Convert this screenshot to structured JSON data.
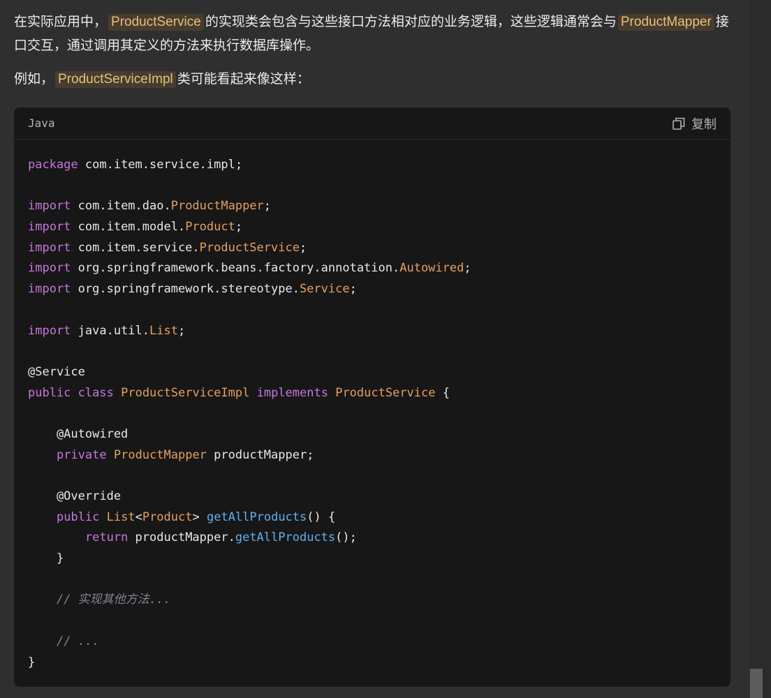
{
  "message": {
    "paragraph1": {
      "part1": "在实际应用中，",
      "code1": "ProductService",
      "part2": "的实现类会包含与这些接口方法相对应的业务逻辑，这些逻辑通常会与",
      "code2": "ProductMapper",
      "part3": "接口交互，通过调用其定义的方法来执行数据库操作。"
    },
    "paragraph2": {
      "part1": "例如，",
      "code1": "ProductServiceImpl",
      "part2": "类可能看起来像这样："
    }
  },
  "code_block": {
    "language": "Java",
    "copy_label": "复制",
    "copy_icon": "copy-icon",
    "lines": [
      [
        {
          "t": "package",
          "c": "kw"
        },
        {
          "t": " com.item.service.impl;",
          "c": "plain"
        }
      ],
      [],
      [
        {
          "t": "import",
          "c": "kw"
        },
        {
          "t": " com.item.dao.",
          "c": "plain"
        },
        {
          "t": "ProductMapper",
          "c": "type"
        },
        {
          "t": ";",
          "c": "plain"
        }
      ],
      [
        {
          "t": "import",
          "c": "kw"
        },
        {
          "t": " com.item.model.",
          "c": "plain"
        },
        {
          "t": "Product",
          "c": "type"
        },
        {
          "t": ";",
          "c": "plain"
        }
      ],
      [
        {
          "t": "import",
          "c": "kw"
        },
        {
          "t": " com.item.service.",
          "c": "plain"
        },
        {
          "t": "ProductService",
          "c": "type"
        },
        {
          "t": ";",
          "c": "plain"
        }
      ],
      [
        {
          "t": "import",
          "c": "kw"
        },
        {
          "t": " org.springframework.beans.factory.annotation.",
          "c": "plain"
        },
        {
          "t": "Autowired",
          "c": "type"
        },
        {
          "t": ";",
          "c": "plain"
        }
      ],
      [
        {
          "t": "import",
          "c": "kw"
        },
        {
          "t": " org.springframework.stereotype.",
          "c": "plain"
        },
        {
          "t": "Service",
          "c": "type"
        },
        {
          "t": ";",
          "c": "plain"
        }
      ],
      [],
      [
        {
          "t": "import",
          "c": "kw"
        },
        {
          "t": " java.util.",
          "c": "plain"
        },
        {
          "t": "List",
          "c": "type"
        },
        {
          "t": ";",
          "c": "plain"
        }
      ],
      [],
      [
        {
          "t": "@Service",
          "c": "ann"
        }
      ],
      [
        {
          "t": "public",
          "c": "kw"
        },
        {
          "t": " ",
          "c": "plain"
        },
        {
          "t": "class",
          "c": "kw"
        },
        {
          "t": " ",
          "c": "plain"
        },
        {
          "t": "ProductServiceImpl",
          "c": "type"
        },
        {
          "t": " ",
          "c": "plain"
        },
        {
          "t": "implements",
          "c": "kw"
        },
        {
          "t": " ",
          "c": "plain"
        },
        {
          "t": "ProductService",
          "c": "type"
        },
        {
          "t": " {",
          "c": "plain"
        }
      ],
      [],
      [
        {
          "t": "    @Autowired",
          "c": "ann"
        }
      ],
      [
        {
          "t": "    ",
          "c": "plain"
        },
        {
          "t": "private",
          "c": "kw"
        },
        {
          "t": " ",
          "c": "plain"
        },
        {
          "t": "ProductMapper",
          "c": "type"
        },
        {
          "t": " productMapper;",
          "c": "plain"
        }
      ],
      [],
      [
        {
          "t": "    @Override",
          "c": "ann"
        }
      ],
      [
        {
          "t": "    ",
          "c": "plain"
        },
        {
          "t": "public",
          "c": "kw"
        },
        {
          "t": " ",
          "c": "plain"
        },
        {
          "t": "List",
          "c": "type"
        },
        {
          "t": "<",
          "c": "plain"
        },
        {
          "t": "Product",
          "c": "type"
        },
        {
          "t": "> ",
          "c": "plain"
        },
        {
          "t": "getAllProducts",
          "c": "fn"
        },
        {
          "t": "() {",
          "c": "plain"
        }
      ],
      [
        {
          "t": "        ",
          "c": "plain"
        },
        {
          "t": "return",
          "c": "kw"
        },
        {
          "t": " productMapper.",
          "c": "plain"
        },
        {
          "t": "getAllProducts",
          "c": "fn"
        },
        {
          "t": "();",
          "c": "plain"
        }
      ],
      [
        {
          "t": "    }",
          "c": "plain"
        }
      ],
      [],
      [
        {
          "t": "    ",
          "c": "plain"
        },
        {
          "t": "// 实现其他方法...",
          "c": "cm"
        }
      ],
      [],
      [
        {
          "t": "    ",
          "c": "plain"
        },
        {
          "t": "// ...",
          "c": "cm"
        }
      ],
      [
        {
          "t": "}",
          "c": "plain"
        }
      ]
    ]
  }
}
